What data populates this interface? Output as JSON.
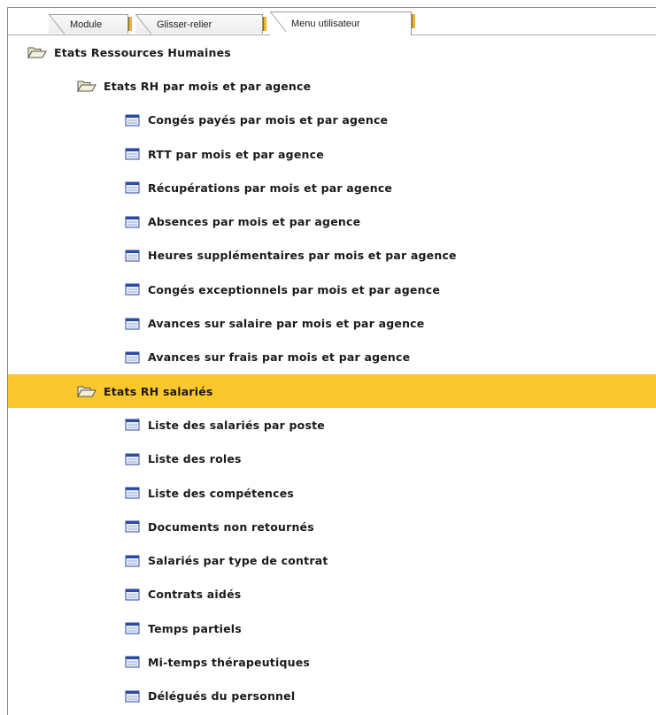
{
  "tabs": [
    {
      "label": "Module",
      "active": false
    },
    {
      "label": "Glisser-relier",
      "active": false
    },
    {
      "label": "Menu utilisateur",
      "active": true
    }
  ],
  "tree": {
    "root": {
      "label": "Etats Ressources Humaines",
      "icon": "folder-open-icon"
    },
    "group1": {
      "label": "Etats RH par mois et par agence",
      "icon": "folder-open-icon",
      "items": [
        {
          "label": "Congés payés par mois et par agence"
        },
        {
          "label": "RTT par mois et par agence"
        },
        {
          "label": "Récupérations par mois et par agence"
        },
        {
          "label": "Absences par mois et par agence"
        },
        {
          "label": "Heures supplémentaires par mois et par agence"
        },
        {
          "label": "Congés exceptionnels par mois et par agence"
        },
        {
          "label": "Avances sur salaire par mois et par agence"
        },
        {
          "label": "Avances sur frais par mois et par agence"
        }
      ]
    },
    "group2": {
      "label": "Etats RH salariés",
      "icon": "folder-open-icon",
      "selected": true,
      "items": [
        {
          "label": "Liste des salariés par poste"
        },
        {
          "label": "Liste des roles"
        },
        {
          "label": "Liste des compétences"
        },
        {
          "label": "Documents non retournés"
        },
        {
          "label": "Salariés par type de contrat"
        },
        {
          "label": "Contrats aidés"
        },
        {
          "label": "Temps partiels"
        },
        {
          "label": "Mi-temps thérapeutiques"
        },
        {
          "label": "Délégués du personnel"
        }
      ]
    }
  },
  "colors": {
    "selection": "#fac72d",
    "folder": "#efe8c8",
    "doc_titlebar": "#2b4aa8"
  }
}
